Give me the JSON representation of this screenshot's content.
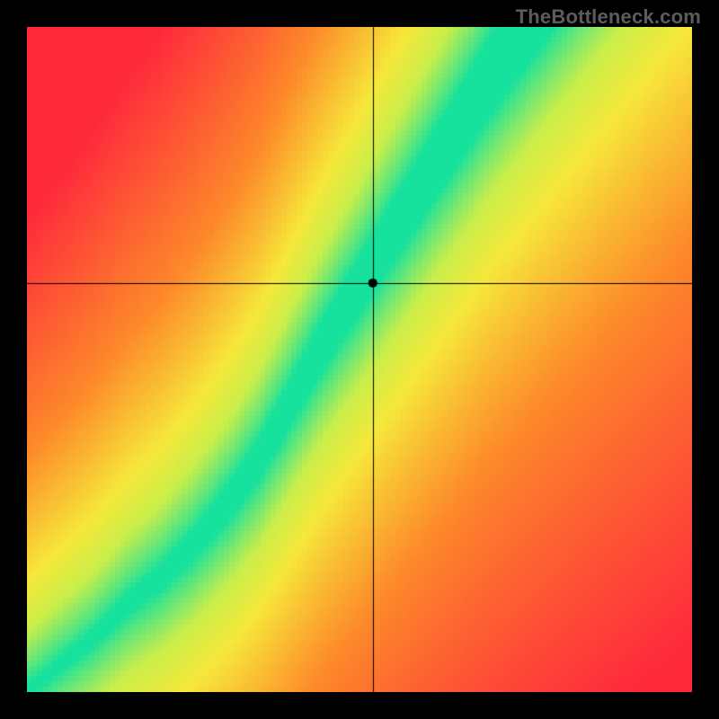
{
  "watermark": "TheBottleneck.com",
  "chart_data": {
    "type": "heatmap",
    "title": "",
    "xlabel": "",
    "ylabel": "",
    "xlim": [
      0,
      1
    ],
    "ylim": [
      0,
      1
    ],
    "crosshair": {
      "x": 0.52,
      "y": 0.615
    },
    "optimal_curve": [
      {
        "x": 0.0,
        "y": 0.0
      },
      {
        "x": 0.05,
        "y": 0.04
      },
      {
        "x": 0.1,
        "y": 0.08
      },
      {
        "x": 0.15,
        "y": 0.13
      },
      {
        "x": 0.2,
        "y": 0.17
      },
      {
        "x": 0.25,
        "y": 0.22
      },
      {
        "x": 0.3,
        "y": 0.28
      },
      {
        "x": 0.35,
        "y": 0.35
      },
      {
        "x": 0.4,
        "y": 0.44
      },
      {
        "x": 0.45,
        "y": 0.53
      },
      {
        "x": 0.5,
        "y": 0.61
      },
      {
        "x": 0.55,
        "y": 0.69
      },
      {
        "x": 0.6,
        "y": 0.77
      },
      {
        "x": 0.65,
        "y": 0.85
      },
      {
        "x": 0.7,
        "y": 0.93
      },
      {
        "x": 0.75,
        "y": 1.0
      }
    ],
    "band_halfwidth_curve": [
      {
        "x": 0.0,
        "w": 0.008
      },
      {
        "x": 0.1,
        "w": 0.012
      },
      {
        "x": 0.2,
        "w": 0.018
      },
      {
        "x": 0.3,
        "w": 0.026
      },
      {
        "x": 0.4,
        "w": 0.034
      },
      {
        "x": 0.5,
        "w": 0.042
      },
      {
        "x": 0.6,
        "w": 0.05
      },
      {
        "x": 0.7,
        "w": 0.058
      },
      {
        "x": 0.8,
        "w": 0.064
      },
      {
        "x": 0.9,
        "w": 0.07
      },
      {
        "x": 1.0,
        "w": 0.076
      }
    ],
    "colors": {
      "green": "#16e19d",
      "yellow": "#f6e83a",
      "orange": "#fd8a2a",
      "red": "#fe2a3c"
    },
    "color_stops": [
      {
        "t": 0.0,
        "c": "#16e19d"
      },
      {
        "t": 0.16,
        "c": "#c9ee4a"
      },
      {
        "t": 0.28,
        "c": "#f6e83a"
      },
      {
        "t": 0.55,
        "c": "#fd8a2a"
      },
      {
        "t": 1.0,
        "c": "#fe2a3c"
      }
    ],
    "pixelation": 128,
    "frame_color": "#000000",
    "crosshair_color": "#000000",
    "marker_radius_px": 5
  }
}
